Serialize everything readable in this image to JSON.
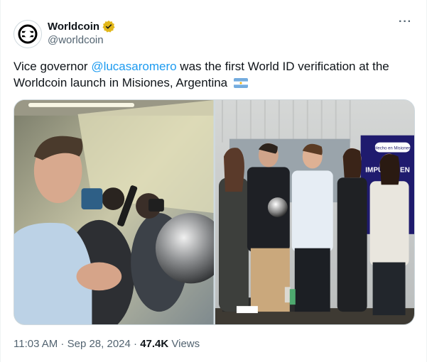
{
  "author": {
    "name": "Worldcoin",
    "handle": "@worldcoin",
    "verified_icon": "verified-badge-icon",
    "verified_color": "#e2b719"
  },
  "more_icon": "more-options-icon",
  "more_label": "···",
  "tweet": {
    "text_before": "Vice governor ",
    "mention": "@lucasaromero",
    "text_after": " was the first World ID verification at the Worldcoin launch in Misiones, Argentina",
    "flag_icon": "argentina-flag-icon"
  },
  "media": {
    "photos": [
      {
        "icon": "photo-left"
      },
      {
        "icon": "photo-right",
        "banner_text": "Hecho en Misiones",
        "sign_text": "IMPULS MEN"
      }
    ]
  },
  "meta": {
    "time": "11:03 AM",
    "sep1": " · ",
    "date": "Sep 28, 2024",
    "sep2": " · ",
    "views_count": "47.4K",
    "views_label": " Views"
  },
  "colors": {
    "link": "#1d9bf0",
    "secondary_text": "#536471"
  }
}
